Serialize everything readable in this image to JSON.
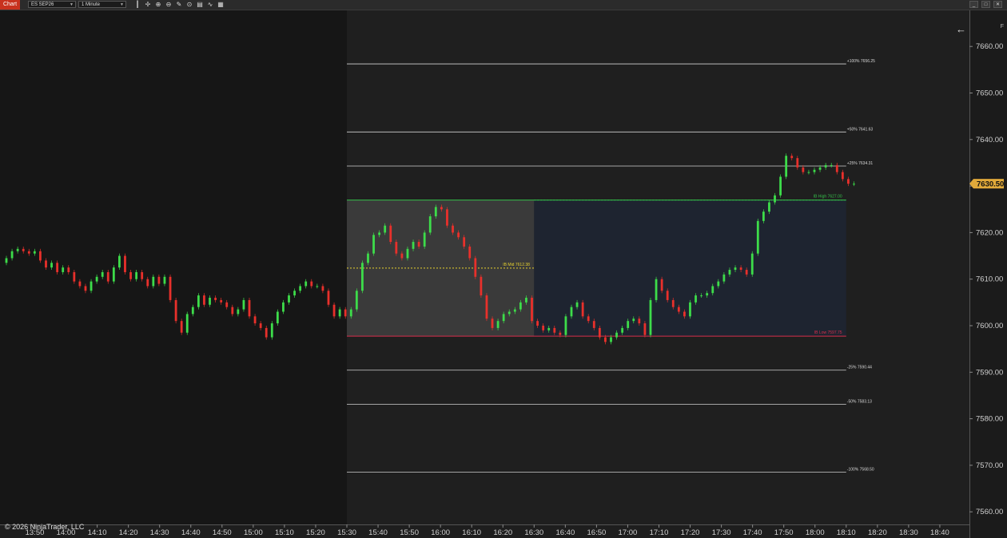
{
  "toolbar": {
    "tab": "Chart",
    "instrument": "ES SEP26",
    "interval": "1 Minute",
    "tools": [
      "bars-icon",
      "crosshair-icon",
      "zoom-in-icon",
      "zoom-out-icon",
      "draw-pencil-icon",
      "global-draw-icon",
      "chart-style-icon",
      "indicators-icon",
      "properties-icon"
    ],
    "right_buttons": [
      "minimize-icon",
      "maximize-icon",
      "close-icon"
    ]
  },
  "chart": {
    "copyright": "© 2026 NinjaTrader, LLC",
    "corner_label": "F",
    "current_price": "7630.50",
    "colors": {
      "bg": "#1f1f1f",
      "bg_left": "#161616",
      "up": "#3ddc4a",
      "down": "#e8302b",
      "ib_range_box": "#3a3a3a",
      "ib_post_box": "#1e2430",
      "ib_high": "#35c04a",
      "ib_low": "#d62f4c",
      "ib_mid": "#e6d12f",
      "ext": "#d0d0d0",
      "axis_text": "#d0d0d0",
      "price_badge": "#e0a93a"
    }
  },
  "chart_data": {
    "type": "candlestick",
    "instrument": "ES SEP26",
    "interval": "1 Minute",
    "x_ticks": [
      "13:50",
      "14:00",
      "14:10",
      "14:20",
      "14:30",
      "14:40",
      "14:50",
      "15:00",
      "15:10",
      "15:20",
      "15:30",
      "15:40",
      "15:50",
      "16:00",
      "16:10",
      "16:20",
      "16:30",
      "16:40",
      "16:50",
      "17:00",
      "17:10",
      "17:20",
      "17:30",
      "17:40",
      "17:50",
      "18:00",
      "18:10",
      "18:20",
      "18:30",
      "18:40"
    ],
    "y_ticks": [
      "7660.00",
      "7650.00",
      "7640.00",
      "7630.00",
      "7620.00",
      "7610.00",
      "7600.00",
      "7590.00",
      "7580.00",
      "7570.00",
      "7560.00"
    ],
    "ylim": [
      7558,
      1667
    ],
    "initial_balance": {
      "start": "15:30",
      "end": "16:30",
      "extend_to": "18:10",
      "high": {
        "label": "IB High",
        "value": "7627.00"
      },
      "mid": {
        "label": "IB Mid",
        "value": "7612.38"
      },
      "low": {
        "label": "IB Low",
        "value": "7597.75"
      }
    },
    "extensions": [
      {
        "label": "+100%",
        "value": "7656.25"
      },
      {
        "label": "+50%",
        "value": "7641.63"
      },
      {
        "label": "+25%",
        "value": "7634.31"
      },
      {
        "label": "-25%",
        "value": "7590.44"
      },
      {
        "label": "-50%",
        "value": "7583.13"
      },
      {
        "label": "-100%",
        "value": "7568.50"
      }
    ],
    "closes": [
      7614.5,
      7616,
      7616.5,
      7616,
      7615.5,
      7616,
      7614,
      7612.5,
      7613.5,
      7611.5,
      7612.5,
      7611.5,
      7609.5,
      7608.5,
      7607.5,
      7609.5,
      7610.5,
      7611.5,
      7609.5,
      7612.5,
      7615,
      7611.5,
      7610,
      7611.5,
      7610,
      7608.5,
      7610.5,
      7609,
      7610.5,
      7605.5,
      7601,
      7598.5,
      7602.5,
      7604,
      7606.5,
      7604.5,
      7606,
      7605.5,
      7605,
      7604,
      7602.5,
      7603.5,
      7605.5,
      7602,
      7600.5,
      7599.5,
      7597.5,
      7600.5,
      7603,
      7605,
      7606.5,
      7607.5,
      7608.5,
      7609.5,
      7608.5,
      7608.5,
      7607.5,
      7604.5,
      7602,
      7603.5,
      7602,
      7603.5,
      7607.5,
      7613.5,
      7615.5,
      7619.5,
      7620,
      7621.5,
      7618,
      7615.5,
      7614.5,
      7616.5,
      7618,
      7617,
      7620,
      7623.5,
      7625.5,
      7625,
      7621.5,
      7620,
      7619,
      7617,
      7614.5,
      7610.5,
      7606.5,
      7601.5,
      7599.5,
      7601,
      7602.5,
      7603,
      7603.5,
      7605,
      7606,
      7601,
      7600,
      7599,
      7599.5,
      7598.5,
      7598,
      7602,
      7604,
      7605,
      7602,
      7601,
      7599.5,
      7597.5,
      7596.5,
      7597.5,
      7598.5,
      7599.5,
      7601,
      7601.5,
      7600.5,
      7598,
      7605.5,
      7610,
      7607.5,
      7605.5,
      7604,
      7603,
      7602,
      7605,
      7606.5,
      7606.5,
      7607,
      7608.5,
      7609.5,
      7611,
      7612,
      7612.5,
      7612,
      7611,
      7615.5,
      7622.5,
      7624.5,
      7626.5,
      7628,
      7632,
      7636.5,
      7636,
      7634,
      7633,
      7633,
      7633.5,
      7634,
      7634.5,
      7634.5,
      7633,
      7631.5,
      7630.5,
      7630.5
    ]
  }
}
